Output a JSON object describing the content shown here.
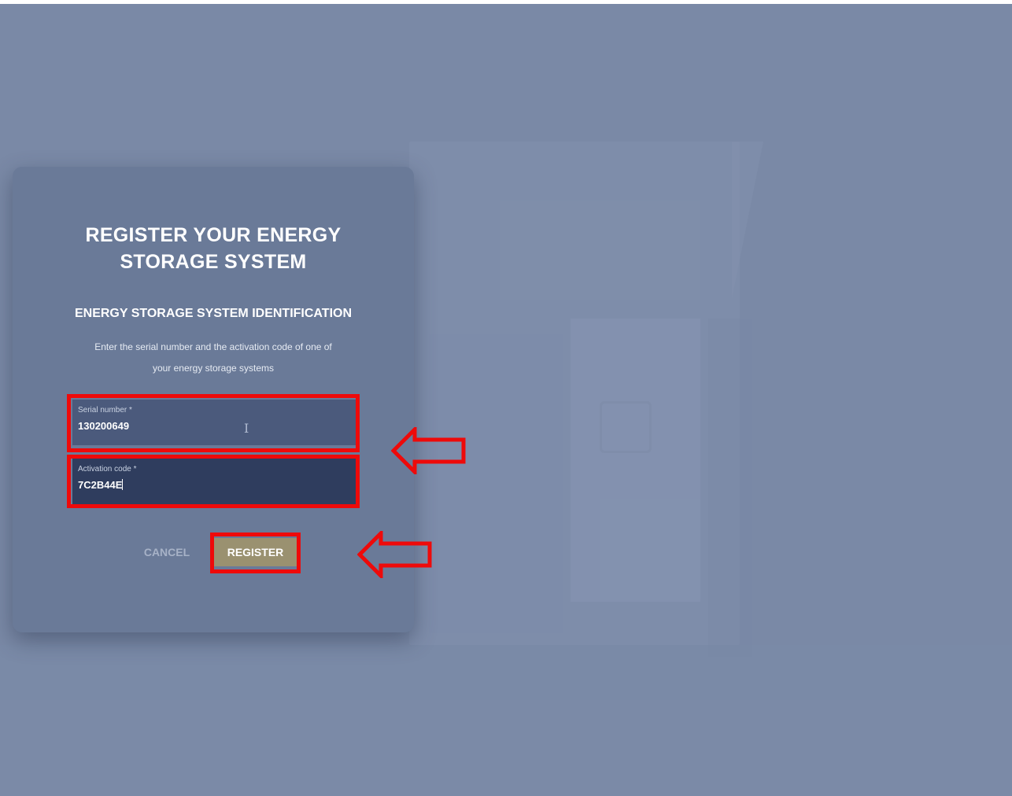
{
  "dialog": {
    "title_line1": "REGISTER YOUR ENERGY",
    "title_line2": "STORAGE SYSTEM",
    "subtitle": "ENERGY STORAGE SYSTEM IDENTIFICATION",
    "description_line1": "Enter the serial number and the activation code of one of",
    "description_line2": "your energy storage systems",
    "serial_field": {
      "label": "Serial number *",
      "value": "130200649"
    },
    "activation_field": {
      "label": "Activation code *",
      "value": "7C2B44E"
    },
    "cancel_label": "CANCEL",
    "register_label": "REGISTER"
  },
  "annotations": {
    "highlight_color": "#ee0a0a",
    "arrow_icon": "left-arrow-icon"
  },
  "colors": {
    "background": "#7a89a6",
    "card": "#6a7a98",
    "register_button": "#9a9170",
    "activation_field_active": "#2f3d5e"
  }
}
